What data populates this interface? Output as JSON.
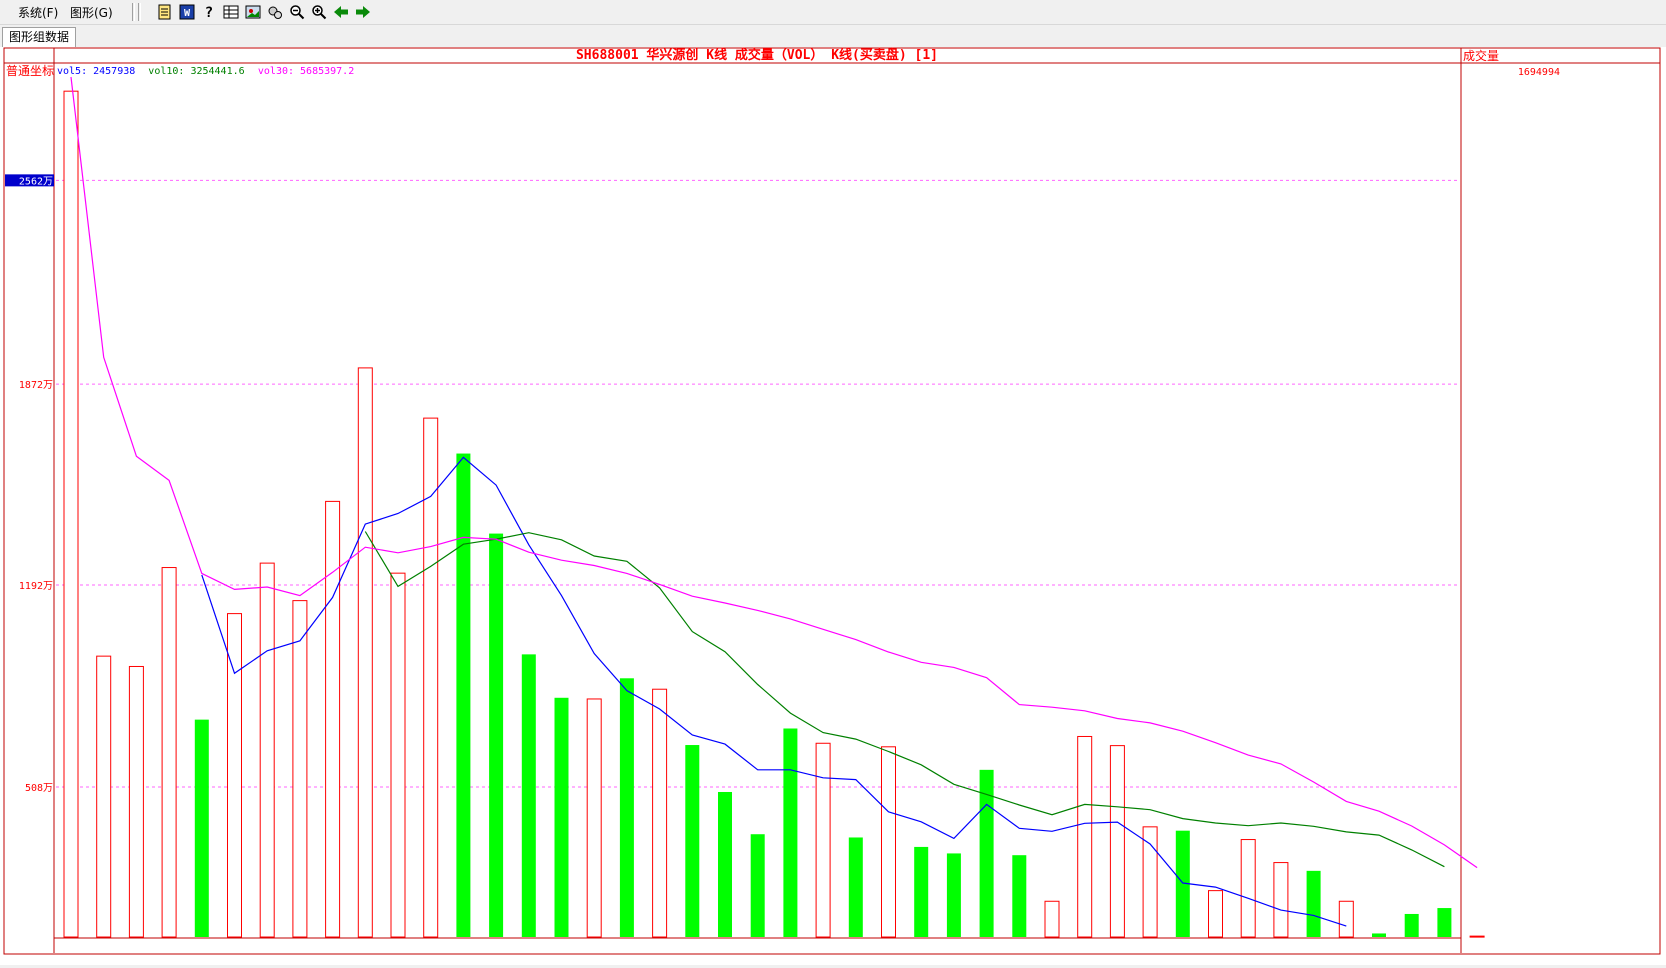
{
  "menu": {
    "system": "系统(F)",
    "graphics": "图形(G)"
  },
  "toolbar_icons": [
    "document-icon",
    "word-icon",
    "help-icon",
    "table-icon",
    "image-icon",
    "settings-icon",
    "zoom-out-icon",
    "zoom-in-icon",
    "back-arrow-icon",
    "forward-arrow-icon"
  ],
  "tab": {
    "label": "图形组数据"
  },
  "colors": {
    "up": "#ff0000",
    "down": "#00ff00",
    "vol5": "#0000ff",
    "vol10": "#008000",
    "vol30": "#ff00ff",
    "frame": "#c00000",
    "grid": "#ff66ff"
  },
  "chart_data": {
    "type": "bar",
    "title": "SH688001 华兴源创 K线 成交量（VOL） K线(买卖盘) [1]",
    "coord_label": "普通坐标",
    "right_panel_label": "成交量",
    "right_panel_value": "1694994",
    "ylim": [
      0,
      2912
    ],
    "ytick_values": [
      508,
      1192,
      1872,
      2562
    ],
    "ytick_labels": [
      "508万",
      "1192万",
      "1872万",
      "2562万"
    ],
    "highlight_tick_index": 3,
    "grid": true,
    "indicator_legend": [
      {
        "key": "vol5",
        "label": "vol5: 2457938"
      },
      {
        "key": "vol10",
        "label": "vol10: 3254441.6"
      },
      {
        "key": "vol30",
        "label": "vol30: 5685397.2"
      }
    ],
    "values": [
      2864,
      951,
      916,
      1251,
      736,
      1095,
      1266,
      1139,
      1475,
      1927,
      1232,
      1757,
      1637,
      1366,
      957,
      810,
      806,
      876,
      839,
      650,
      491,
      348,
      706,
      656,
      337,
      644,
      305,
      283,
      566,
      277,
      121,
      679,
      648,
      373,
      360,
      157,
      330,
      252,
      224,
      121,
      12,
      78,
      98,
      3
    ],
    "directions": [
      "up",
      "up",
      "up",
      "up",
      "down",
      "up",
      "up",
      "up",
      "up",
      "up",
      "up",
      "up",
      "down",
      "down",
      "down",
      "down",
      "up",
      "down",
      "up",
      "down",
      "down",
      "down",
      "down",
      "up",
      "down",
      "up",
      "down",
      "down",
      "down",
      "down",
      "up",
      "up",
      "up",
      "up",
      "down",
      "up",
      "up",
      "up",
      "down",
      "up",
      "down",
      "down",
      "down",
      "up"
    ],
    "series": [
      {
        "name": "vol5",
        "start": 4,
        "values": [
          1226,
          893,
          969,
          1003,
          1150,
          1398,
          1434,
          1492,
          1624,
          1530,
          1328,
          1156,
          960,
          834,
          772,
          684,
          653,
          566,
          566,
          539,
          533,
          424,
          390,
          334,
          449,
          368,
          358,
          385,
          389,
          315,
          183,
          169,
          131,
          91,
          73,
          37
        ]
      },
      {
        "name": "vol10",
        "start": 9,
        "values": [
          1373,
          1187,
          1255,
          1330,
          1347,
          1369,
          1345,
          1290,
          1272,
          1182,
          1034,
          966,
          855,
          758,
          692,
          670,
          628,
          583,
          517,
          483,
          447,
          414,
          449,
          441,
          431,
          401,
          386,
          377,
          386,
          375,
          356,
          345,
          295,
          238
        ]
      },
      {
        "name": "vol30",
        "start": 0,
        "values": [
          2912,
          1963,
          1628,
          1546,
          1231,
          1177,
          1185,
          1156,
          1235,
          1320,
          1301,
          1322,
          1353,
          1347,
          1303,
          1276,
          1258,
          1231,
          1194,
          1154,
          1131,
          1106,
          1077,
          1042,
          1007,
          965,
          930,
          913,
          878,
          787,
          778,
          766,
          740,
          725,
          697,
          658,
          616,
          586,
          525,
          459,
          426,
          376,
          312,
          235
        ]
      }
    ]
  }
}
